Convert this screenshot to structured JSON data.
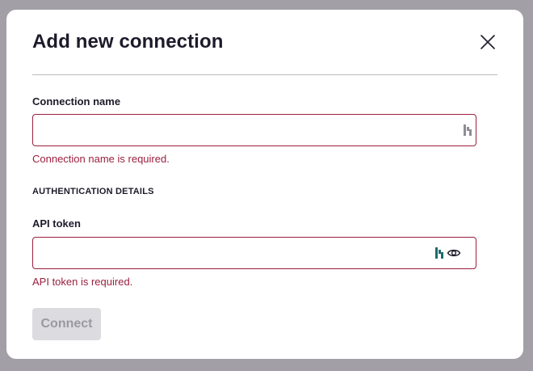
{
  "dialog": {
    "title": "Add new connection"
  },
  "connection_name": {
    "label": "Connection name",
    "value": "",
    "error": "Connection name is required."
  },
  "auth": {
    "heading": "AUTHENTICATION DETAILS",
    "api_token": {
      "label": "API token",
      "value": "",
      "error": "API token is required."
    }
  },
  "actions": {
    "connect_label": "Connect"
  },
  "icons": {
    "close": "close-icon",
    "password_manager": "password-manager-icon",
    "show_password": "eye-icon"
  },
  "colors": {
    "error": "#9b1f3e",
    "overlay": "#a29fa6",
    "disabled_button": "#dcdbe0",
    "password_manager_active": "#1f6b6b"
  }
}
